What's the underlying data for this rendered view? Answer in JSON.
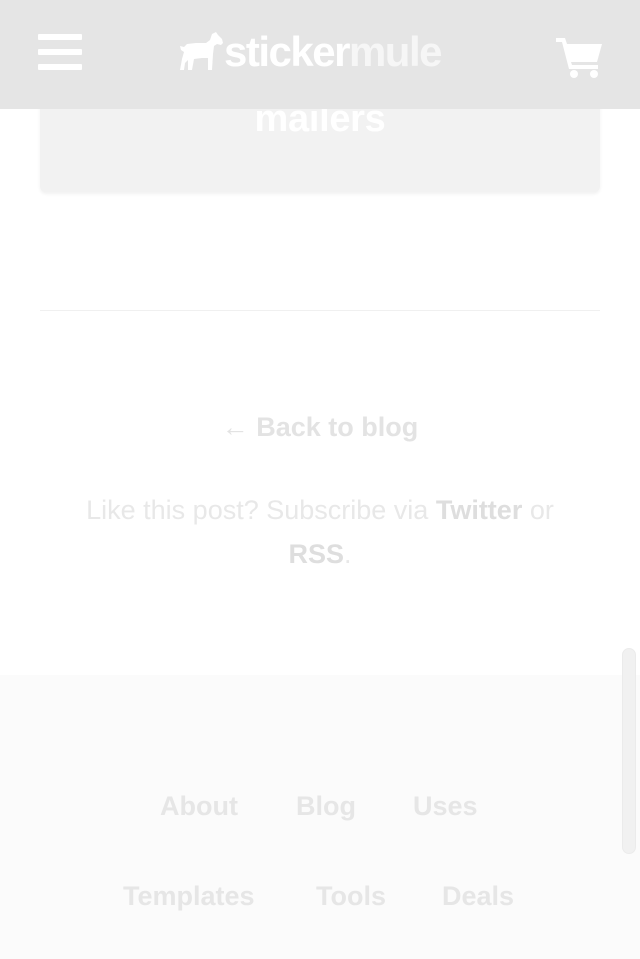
{
  "header": {
    "logo_part1": "sticker",
    "logo_part2": "mule",
    "menu_icon": "hamburger-menu-icon",
    "cart_icon": "shopping-cart-icon"
  },
  "card": {
    "text": "mailers"
  },
  "back": {
    "arrow": "←",
    "label": "Back to blog"
  },
  "subscribe": {
    "prefix": "Like this post? Subscribe via",
    "twitter": "Twitter",
    "or": "or",
    "rss": "RSS",
    "period": "."
  },
  "footer": {
    "links": [
      "About",
      "Blog",
      "Uses",
      "Templates",
      "Tools",
      "Deals"
    ]
  },
  "colors": {
    "header_bg": "#e5e5e5",
    "card_bg": "#f2f2f2",
    "footer_bg": "#fbfbfb",
    "text_faded": "#e3e3e3"
  }
}
